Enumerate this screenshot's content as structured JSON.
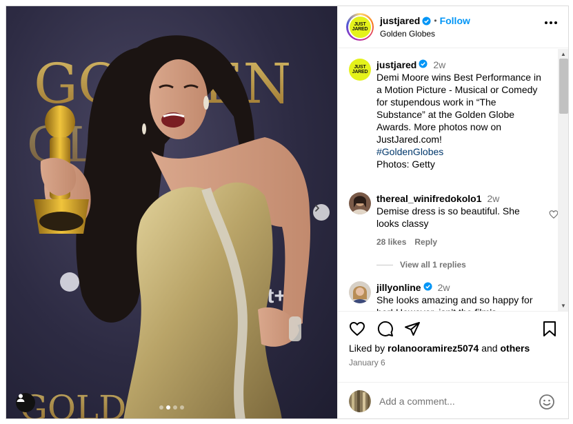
{
  "post": {
    "author": "justjared",
    "location": "Golden Globes",
    "follow_label": "Follow",
    "separator": "•",
    "logo_line1": "JUST",
    "logo_line2": "JARED"
  },
  "caption": {
    "author": "justjared",
    "time": "2w",
    "text": "Demi Moore wins Best Performance in a Motion Picture - Musical or Comedy for stupendous work in “The Substance” at the Golden Globe Awards. More photos now on JustJared.com!",
    "hashtag": "#GoldenGlobes",
    "credit": "Photos: Getty"
  },
  "comments": [
    {
      "author": "thereal_winifredokolo1",
      "time": "2w",
      "text": "Demise dress is so beautiful. She looks classy",
      "likes": "28 likes",
      "reply_label": "Reply",
      "view_replies": "View all 1 replies"
    },
    {
      "author": "jillyonline",
      "time": "2w",
      "text": "She looks amazing and so happy for her! However, isn’t the film’s"
    }
  ],
  "likes": {
    "prefix": "Liked by ",
    "user": "rolanooramirez5074",
    "middle": " and ",
    "others": "others"
  },
  "date": "January 6",
  "add_comment": {
    "placeholder": "Add a comment..."
  },
  "photo_backdrop_text": [
    "GOL",
    "EN",
    "GLOBES",
    "GOLDEN"
  ],
  "carousel": {
    "count": 4,
    "active": 1
  },
  "colors": {
    "accent": "#0095f6",
    "verified": "#0095f6",
    "hashtag": "#00376b",
    "muted": "#737373",
    "logo": "#e4f21b"
  }
}
